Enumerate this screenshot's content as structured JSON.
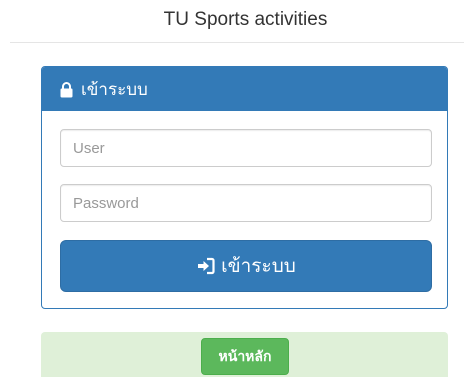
{
  "header": {
    "title": "TU Sports activities"
  },
  "login_panel": {
    "heading": "เข้าระบบ",
    "heading_icon": "lock-icon",
    "user_field": {
      "placeholder": "User",
      "value": ""
    },
    "password_field": {
      "placeholder": "Password",
      "value": ""
    },
    "submit_label": "เข้าระบบ",
    "submit_icon": "sign-in-icon"
  },
  "footer": {
    "home_label": "หน้าหลัก"
  },
  "colors": {
    "primary": "#337ab7",
    "success": "#5cb85c",
    "footer_bg": "#dff0d8"
  }
}
